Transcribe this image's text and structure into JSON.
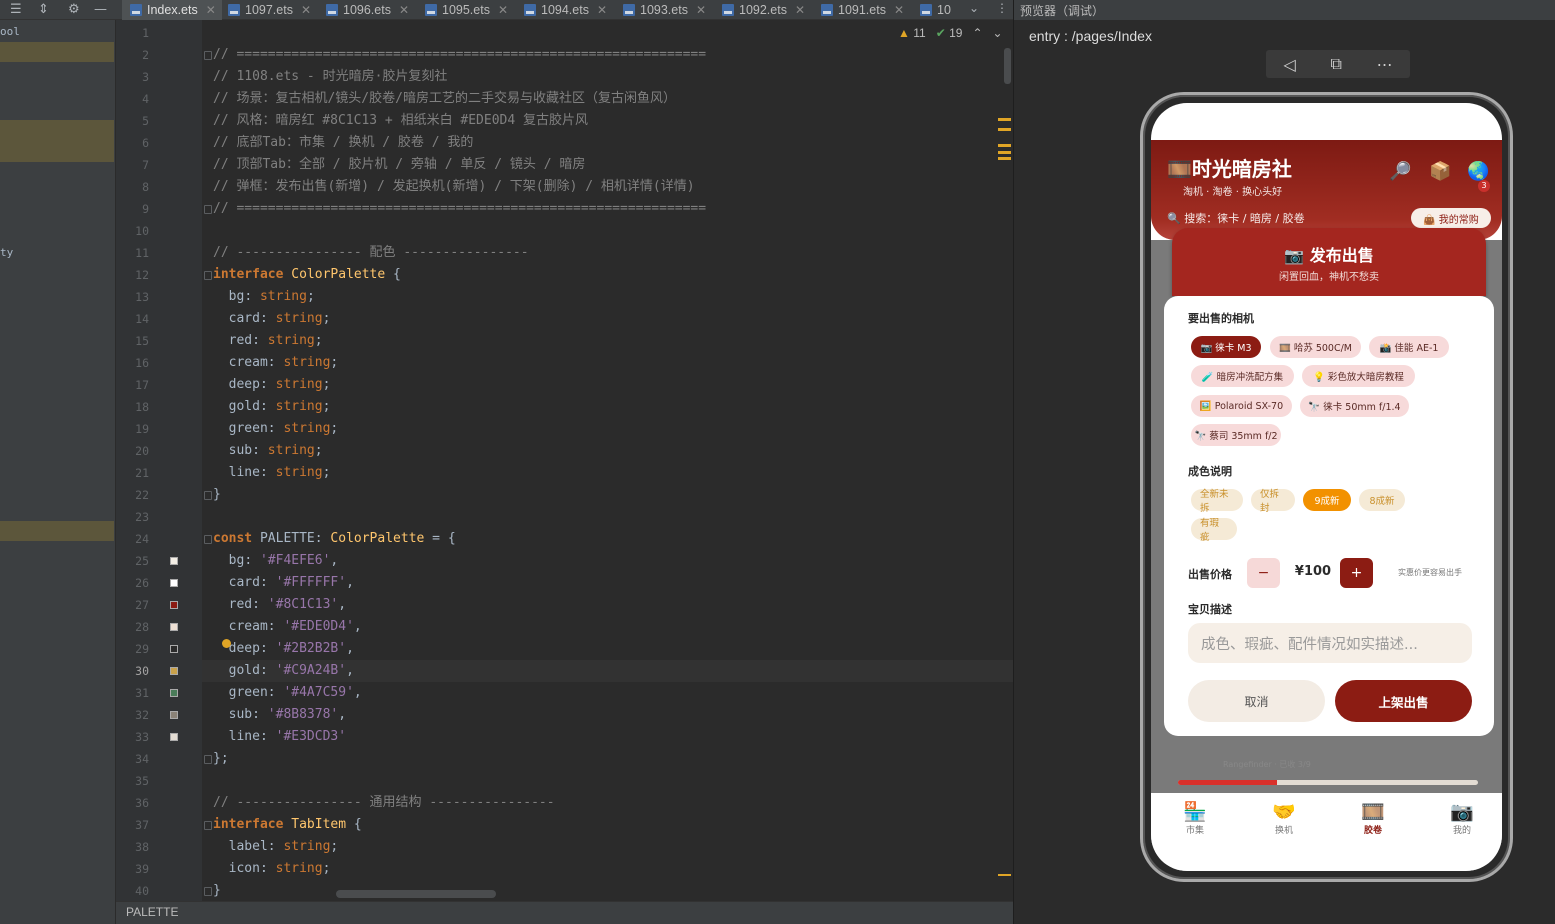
{
  "ide": {
    "open_tabs": [
      {
        "label": "Index.ets",
        "active": true
      },
      {
        "label": "1097.ets"
      },
      {
        "label": "1096.ets"
      },
      {
        "label": "1095.ets"
      },
      {
        "label": "1094.ets"
      },
      {
        "label": "1093.ets"
      },
      {
        "label": "1092.ets"
      },
      {
        "label": "1091.ets"
      },
      {
        "label": "10"
      }
    ],
    "left_panel_fragments": {
      "a": "ool",
      "b": "ty"
    },
    "inspections": {
      "warnings": "11",
      "weak_warnings": "19"
    },
    "status_breadcrumb": "PALETTE",
    "line_numbers": [
      "1",
      "2",
      "3",
      "4",
      "5",
      "6",
      "7",
      "8",
      "9",
      "10",
      "11",
      "12",
      "13",
      "14",
      "15",
      "16",
      "17",
      "18",
      "19",
      "20",
      "21",
      "22",
      "23",
      "24",
      "25",
      "26",
      "27",
      "28",
      "29",
      "30",
      "31",
      "32",
      "33",
      "34",
      "35",
      "36",
      "37",
      "38",
      "39",
      "40"
    ],
    "code": {
      "l2": "// ============================================================",
      "l3": "// 1108.ets - 时光暗房·胶片复刻社",
      "l4": "// 场景：复古相机/镜头/胶卷/暗房工艺的二手交易与收藏社区（复古闲鱼风）",
      "l5": "// 风格：暗房红 #8C1C13 + 相纸米白 #EDE0D4 复古胶片风",
      "l6": "// 底部Tab：市集 / 换机 / 胶卷 / 我的",
      "l7": "// 顶部Tab：全部 / 胶片机 / 旁轴 / 单反 / 镜头 / 暗房",
      "l8": "// 弹框：发布出售(新增) / 发起换机(新增) / 下架(删除) / 相机详情(详情)",
      "l9": "// ============================================================",
      "l11": "// ---------------- 配色 ----------------",
      "kw_interface": "interface",
      "kw_const": "const",
      "colorpalette": "ColorPalette",
      "tabitem": "TabItem",
      "palette": "PALETTE",
      "open_brace": " {",
      "close_brace": "}",
      "close_brace_semi": "};",
      "colon": ":",
      "eq_brace": " = {",
      "semicolon": ";",
      "comma": ",",
      "type_string": "string",
      "fields": [
        "bg",
        "card",
        "red",
        "cream",
        "deep",
        "gold",
        "green",
        "sub",
        "line"
      ],
      "values": [
        "'#F4EFE6'",
        "'#FFFFFF'",
        "'#8C1C13'",
        "'#EDE0D4'",
        "'#2B2B2B'",
        "'#C9A24B'",
        "'#4A7C59'",
        "'#8B8378'",
        "'#E3DCD3'"
      ],
      "swatches": [
        "#F4EFE6",
        "#FFFFFF",
        "#8C1C13",
        "#EDE0D4",
        "#2B2B2B",
        "#C9A24B",
        "#4A7C59",
        "#8B8378",
        "#E3DCD3"
      ],
      "l36": "// ---------------- 通用结构 ----------------",
      "field_label": "label",
      "field_icon": "icon"
    }
  },
  "previewer": {
    "panel_title": "预览器（调试）",
    "entry": "entry : /pages/Index",
    "toolbar_icons": [
      "back-triangle-icon",
      "device-rotate-icon",
      "more-icon"
    ]
  },
  "app": {
    "title_icon": "🎞️",
    "title": "时光暗房社",
    "subtitle": "淘机 · 淘卷 · 换心头好",
    "header_icons": [
      "🔎",
      "📦",
      "🌏"
    ],
    "cart_badge": "3",
    "search_label": "🔍 搜索：徕卡 / 暗房 / 胶卷",
    "fav_button": "👜 我的常购",
    "dialog": {
      "title": "📷 发布出售",
      "subtitle": "闲置回血，神机不愁卖",
      "camera_label": "要出售的相机",
      "cameras": [
        {
          "label": "📷 徕卡 M3",
          "selected": true
        },
        {
          "label": "🎞️ 哈苏 500C/M"
        },
        {
          "label": "📸 佳能 AE-1"
        },
        {
          "label": "🧪 暗房冲洗配方集"
        },
        {
          "label": "💡 彩色放大暗房教程"
        },
        {
          "label": "🖼️ Polaroid SX-70"
        },
        {
          "label": "🔭 徕卡 50mm f/1.4"
        },
        {
          "label": "🔭 蔡司 35mm f/2"
        }
      ],
      "condition_label": "成色说明",
      "conditions": [
        {
          "label": "全新未拆"
        },
        {
          "label": "仅拆封"
        },
        {
          "label": "9成新",
          "selected": true
        },
        {
          "label": "8成新"
        },
        {
          "label": "有瑕疵"
        }
      ],
      "price_label": "出售价格",
      "minus": "−",
      "price": "¥100",
      "plus": "+",
      "price_hint": "实惠价更容易出手",
      "desc_label": "宝贝描述",
      "desc_placeholder": "成色、瑕疵、配件情况如实描述...",
      "cancel": "取消",
      "confirm": "上架出售"
    },
    "below_text": "Rangefinder · 已收 3/9",
    "progress": 0.33,
    "bottom_nav": [
      {
        "icon": "🏪",
        "label": "市集"
      },
      {
        "icon": "🤝",
        "label": "换机"
      },
      {
        "icon": "🎞️",
        "label": "胶卷",
        "active": true
      },
      {
        "icon": "📷",
        "label": "我的"
      }
    ],
    "colors": {
      "red": "#8C1C13",
      "cream": "#EDE0D4",
      "orange": "#F29100"
    }
  }
}
